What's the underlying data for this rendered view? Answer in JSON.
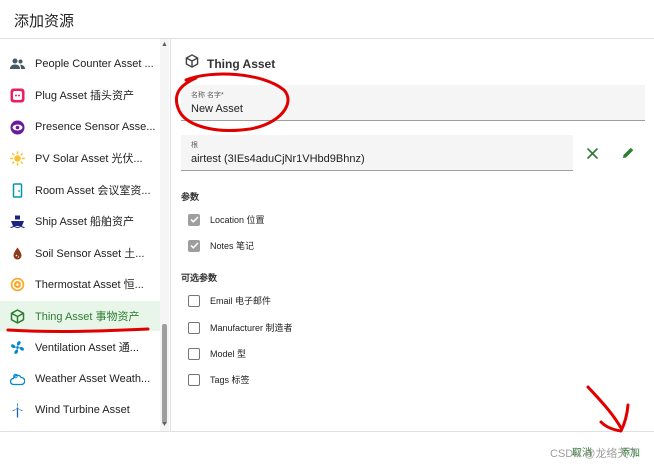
{
  "dialog": {
    "title": "添加资源"
  },
  "sidebar": {
    "items": [
      {
        "label": "People Counter Asset ...",
        "icon": "people-icon"
      },
      {
        "label": "Plug Asset  插头资产",
        "icon": "plug-icon"
      },
      {
        "label": "Presence Sensor Asse...",
        "icon": "eye-icon"
      },
      {
        "label": "PV Solar Asset  光伏...",
        "icon": "sun-icon"
      },
      {
        "label": "Room Asset  会议室资...",
        "icon": "door-icon"
      },
      {
        "label": "Ship Asset  船舶资产",
        "icon": "ship-icon"
      },
      {
        "label": "Soil Sensor Asset  土...",
        "icon": "soil-icon"
      },
      {
        "label": "Thermostat Asset  恒...",
        "icon": "thermostat-icon"
      },
      {
        "label": "Thing Asset  事物资产",
        "icon": "cube-icon",
        "selected": true
      },
      {
        "label": "Ventilation Asset  通...",
        "icon": "fan-icon"
      },
      {
        "label": "Weather Asset  Weath...",
        "icon": "weather-icon"
      },
      {
        "label": "Wind Turbine Asset",
        "icon": "wind-turbine-icon"
      }
    ]
  },
  "main": {
    "title": "Thing Asset",
    "name_field": {
      "label": "名称  名字*",
      "value": "New Asset"
    },
    "root_field": {
      "label": "根",
      "value": "airtest (3IEs4aduCjNr1VHbd9Bhnz)"
    },
    "params_title": "参数",
    "params": [
      {
        "label": "Location  位置",
        "checked": true
      },
      {
        "label": "Notes  笔记",
        "checked": true
      }
    ],
    "optional_title": "可选参数",
    "optional": [
      {
        "label": "Email  电子邮件",
        "checked": false
      },
      {
        "label": "Manufacturer  制造者",
        "checked": false
      },
      {
        "label": "Model  型",
        "checked": false
      },
      {
        "label": "Tags  标签",
        "checked": false
      }
    ]
  },
  "footer": {
    "cancel_label": "取消",
    "add_label": "添加",
    "watermark": "CSDN @龙络天下"
  },
  "colors": {
    "accent": "#2e7d32",
    "annotation": "#e00000"
  }
}
